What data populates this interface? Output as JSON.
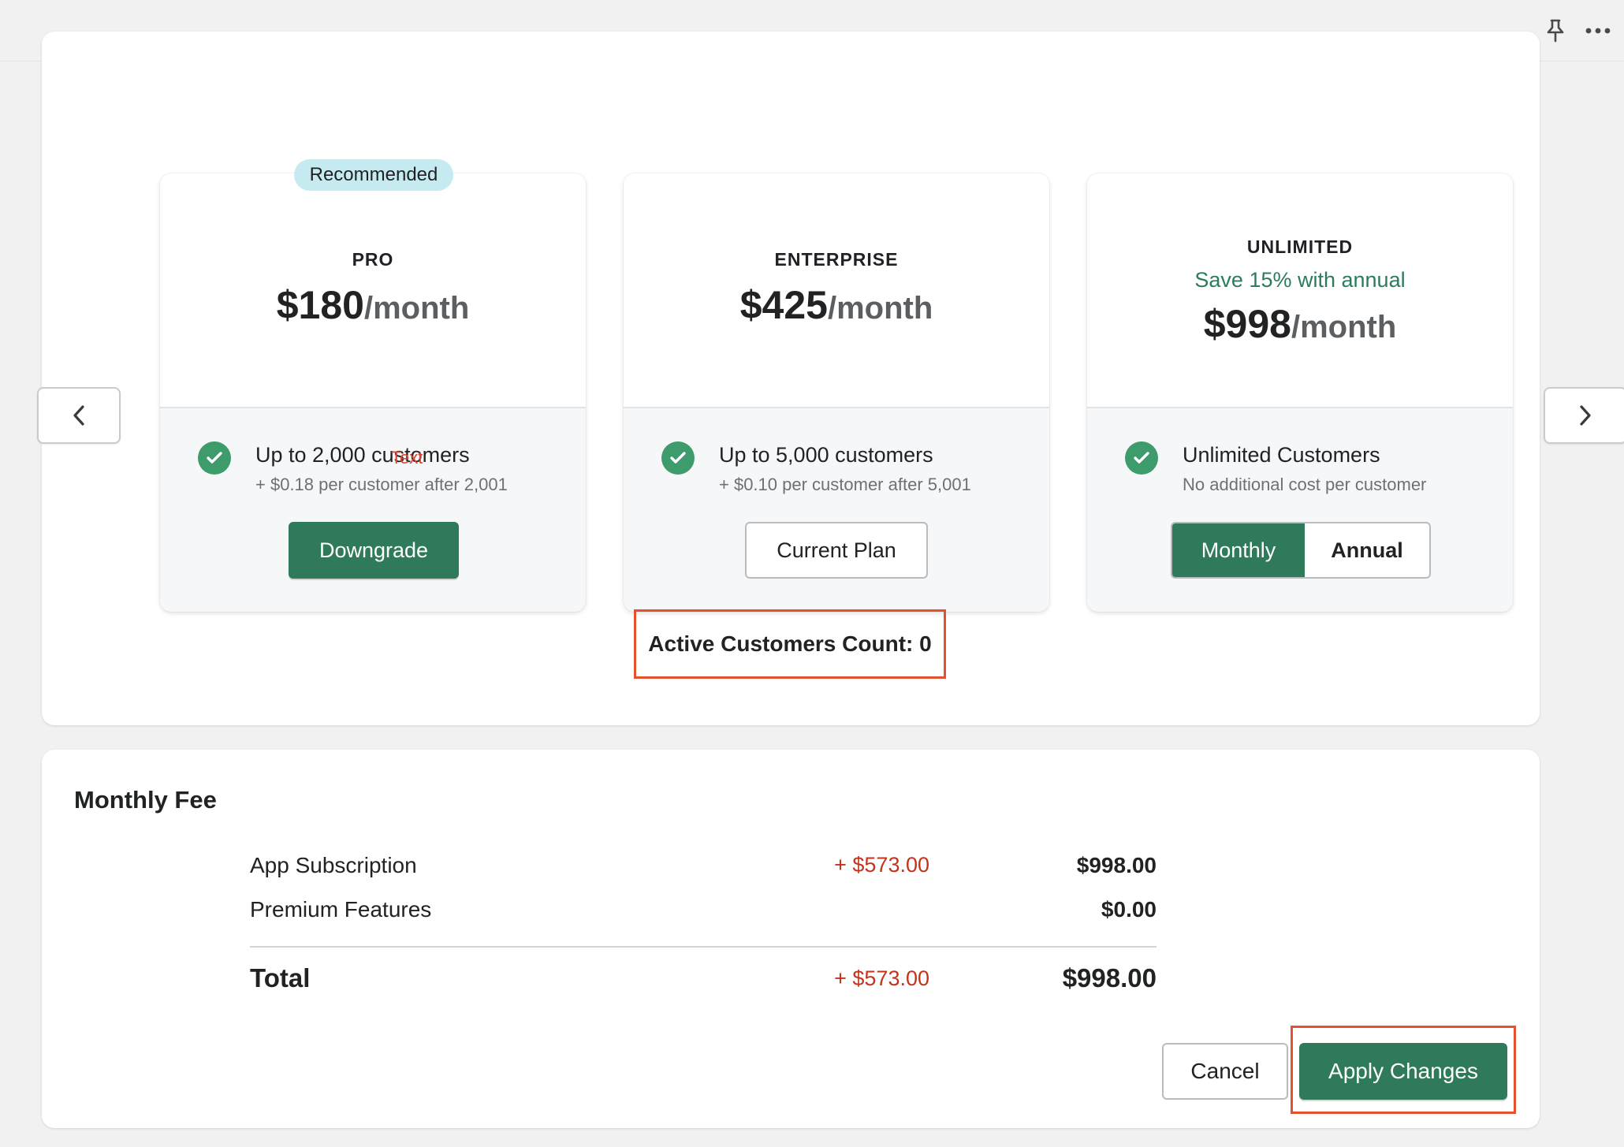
{
  "topbar": {
    "pin_icon": "pin-icon",
    "more_icon": "more-horizontal-icon"
  },
  "plans": [
    {
      "badge": "Recommended",
      "name": "PRO",
      "price": "$180",
      "period": "/month",
      "feature": "Up to 2,000 customers",
      "feature_note": "+ $0.18 per customer after 2,001",
      "button_label": "Downgrade"
    },
    {
      "name": "ENTERPRISE",
      "price": "$425",
      "period": "/month",
      "feature": "Up to 5,000 customers",
      "feature_note": "+ $0.10 per customer after 5,001",
      "button_label": "Current Plan"
    },
    {
      "name": "UNLIMITED",
      "promo": "Save 15% with annual",
      "price": "$998",
      "period": "/month",
      "feature": "Unlimited Customers",
      "feature_note": "No additional cost per customer",
      "billing_options": [
        "Monthly",
        "Annual"
      ],
      "billing_selected": "Monthly"
    }
  ],
  "annotation_text": "Text",
  "active_customers": "Active Customers Count: 0",
  "fee": {
    "title": "Monthly Fee",
    "rows": [
      {
        "label": "App Subscription",
        "delta": "+ $573.00",
        "amount": "$998.00"
      },
      {
        "label": "Premium Features",
        "delta": "",
        "amount": "$0.00"
      }
    ],
    "total": {
      "label": "Total",
      "delta": "+ $573.00",
      "amount": "$998.00"
    }
  },
  "actions": {
    "cancel": "Cancel",
    "apply": "Apply Changes"
  },
  "colors": {
    "brand_green": "#2f7a5b",
    "check_green": "#3e9b6c",
    "delta_red": "#c4331a",
    "highlight": "#e5512e",
    "badge_bg": "#c5eaf0"
  }
}
